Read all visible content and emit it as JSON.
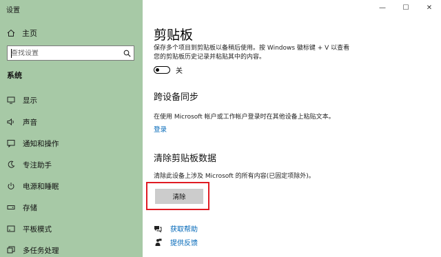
{
  "window": {
    "title": "设置",
    "minimize": "—",
    "maximize": "☐",
    "close": "✕"
  },
  "sidebar": {
    "home_label": "主页",
    "search_placeholder": "查找设置",
    "section": "系统",
    "items": [
      {
        "label": "显示",
        "icon": "display-icon"
      },
      {
        "label": "声音",
        "icon": "sound-icon"
      },
      {
        "label": "通知和操作",
        "icon": "notifications-icon"
      },
      {
        "label": "专注助手",
        "icon": "focus-assist-icon"
      },
      {
        "label": "电源和睡眠",
        "icon": "power-icon"
      },
      {
        "label": "存储",
        "icon": "storage-icon"
      },
      {
        "label": "平板模式",
        "icon": "tablet-mode-icon"
      },
      {
        "label": "多任务处理",
        "icon": "multitasking-icon"
      }
    ]
  },
  "main": {
    "title": "剪贴板",
    "history_desc_line1": "保存多个项目到剪贴板以备稍后使用。按 Windows 徽标键 + V 以查看",
    "history_desc_line2": "您的剪贴板历史记录并粘贴其中的内容。",
    "toggle_label": "关",
    "toggle_state": "off",
    "sync_heading": "跨设备同步",
    "sync_desc": "在使用 Microsoft 帐户或工作帐户登录时在其他设备上粘贴文本。",
    "sign_in_link": "登录",
    "clear_heading": "清除剪贴板数据",
    "clear_desc": "清除此设备上涉及 Microsoft 的所有内容(已固定项除外)。",
    "clear_button": "清除",
    "help_link": "获取帮助",
    "feedback_link": "提供反馈"
  },
  "colors": {
    "sidebar_bg": "#a7c9a6",
    "accent": "#0067b8",
    "highlight": "#e01a22"
  }
}
